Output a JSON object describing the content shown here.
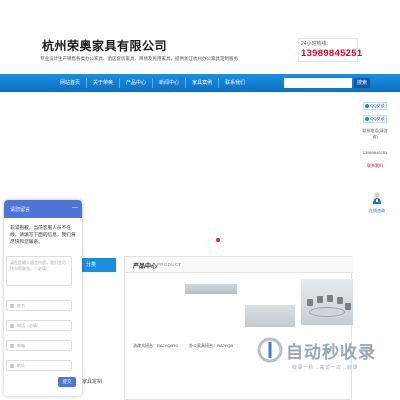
{
  "header": {
    "title": "杭州荣奥家具有限公司",
    "slogan": "专业设计生产销售各类办公家具、酒店套房家具、简易及民用家具，提供浙江杭州办公家具定制服务",
    "hotline_label": "24小时热线：",
    "hotline_number": "13989845251"
  },
  "nav": {
    "items": [
      "网站首页",
      "关于荣奥",
      "产品中心",
      "新闻中心",
      "家具案例",
      "联系我们"
    ],
    "search_placeholder": "",
    "search_button": "搜索"
  },
  "right_float": {
    "qq_buttons": [
      "QQ交谈",
      "QQ交谈"
    ],
    "contact_text": "联系电话(请咨询)",
    "phone": "13989845251",
    "link_text": "联系我们"
  },
  "consult": {
    "label": "在线咨询"
  },
  "product_panel": {
    "title": "产品中心",
    "title_en": "PRODUCT",
    "captions": [
      "油漆大班台：RAJYQBT0",
      "办公家具班台：RAJYQB"
    ]
  },
  "chat": {
    "header_title": "请您留言",
    "minimize": "—",
    "message": "非常抱歉，当前客服人员不在线。请填写下面的信息，我们将尽快和您联系。",
    "textarea_placeholder": "请在此输入留言内容，我们会尽快与您联系。（必填）",
    "fields": [
      "姓名",
      "电话（必填）",
      "邮箱",
      "地址"
    ],
    "submit": "提交"
  },
  "background": {
    "category_tab": "分类",
    "fragment": "家具定制"
  },
  "watermark": {
    "text": "自动秒收录",
    "sub": "收录一秒→来访一次→收录"
  }
}
